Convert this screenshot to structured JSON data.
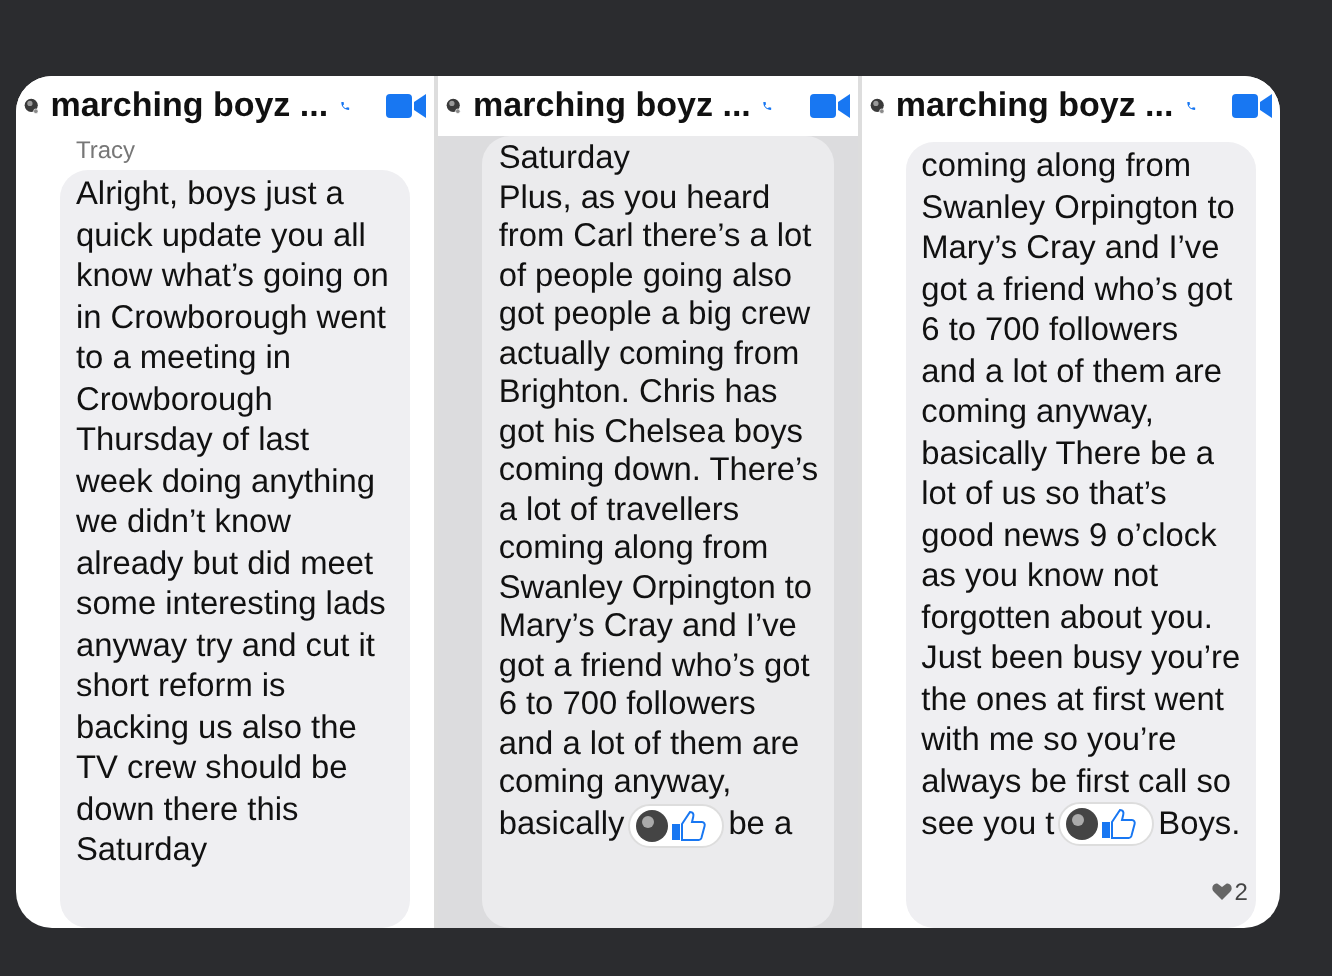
{
  "panels": [
    {
      "title": "marching boyz ...",
      "sender": "Tracy",
      "lines": [
        "Alright, boys just a",
        "quick update you all",
        "know what’s going on",
        "in Crowborough went",
        "to a meeting in",
        "Crowborough",
        "Thursday of last",
        "week doing anything",
        "we didn’t know",
        "already but did meet",
        "some interesting lads",
        "anyway try and cut it",
        "short reform is",
        "backing us also the",
        "TV crew should be",
        "down there this",
        "Saturday"
      ]
    },
    {
      "title": "marching boyz ...",
      "lines": [
        "Saturday",
        "Plus, as you heard",
        "from Carl there’s a lot",
        "of people going also",
        "got people a big crew",
        "actually coming from",
        "Brighton. Chris has",
        "got his Chelsea boys",
        "coming down. There’s",
        "a lot of travellers",
        "coming along from",
        "Swanley Orpington to",
        "Mary’s Cray and I’ve",
        "got a friend who’s got",
        "6 to 700 followers",
        "and a lot of them are",
        "coming anyway,",
        "basically"
      ],
      "reaction": {
        "text_after": "be a"
      }
    },
    {
      "title": "marching boyz ...",
      "lines": [
        "coming along from",
        "Swanley Orpington to",
        "Mary’s Cray and I’ve",
        "got a friend who’s got",
        "6 to 700 followers",
        "and a lot of them are",
        "coming anyway,",
        "basically There be a",
        "lot of us so that’s",
        "good news 9 o’clock",
        "as you know not",
        "forgotten about you.",
        "Just been busy you’re",
        "the ones at first went",
        "with me so you’re",
        "always be first call so",
        "see you t"
      ],
      "reaction": {
        "text_after": "Boys."
      },
      "heart_count": "2"
    }
  ]
}
